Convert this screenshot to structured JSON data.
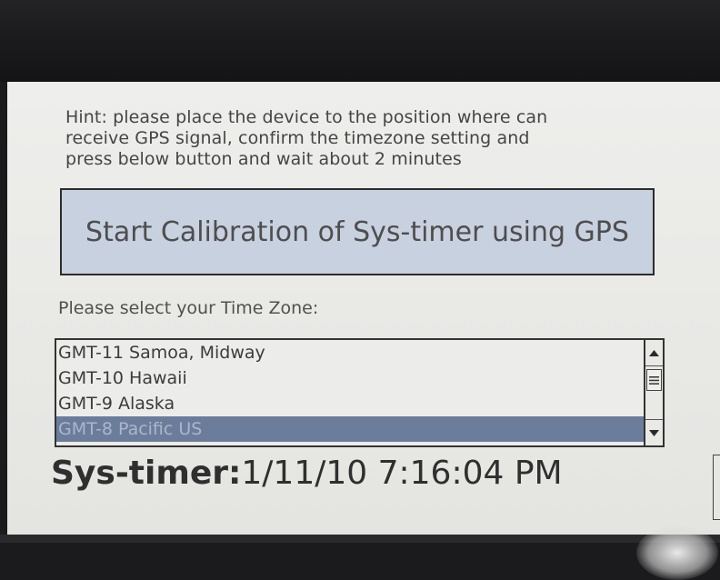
{
  "hint": {
    "lines": [
      "Hint: please place the device to the position where can",
      "receive GPS signal, confirm the timezone setting and",
      "press below button and wait about 2 minutes"
    ]
  },
  "calibration_button": {
    "label": "Start Calibration of Sys-timer using GPS"
  },
  "timezone": {
    "label": "Please select your Time Zone:",
    "options": [
      "GMT-11 Samoa, Midway",
      "GMT-10 Hawaii",
      "GMT-9 Alaska",
      "GMT-8 Pacific US"
    ],
    "selected": "GMT-8 Pacific US"
  },
  "scrollbar": {
    "up_icon": "triangle-up",
    "thumb_icon": "grip-lines",
    "down_icon": "triangle-down"
  },
  "status": {
    "label": "Sys-timer:",
    "value": "1/11/10 7:16:04 PM"
  },
  "colors": {
    "screen_bg": "#eeeeec",
    "button_bg": "#c8d1df",
    "selection_bg": "#6c7d9c",
    "selection_text": "#aab6cc"
  }
}
